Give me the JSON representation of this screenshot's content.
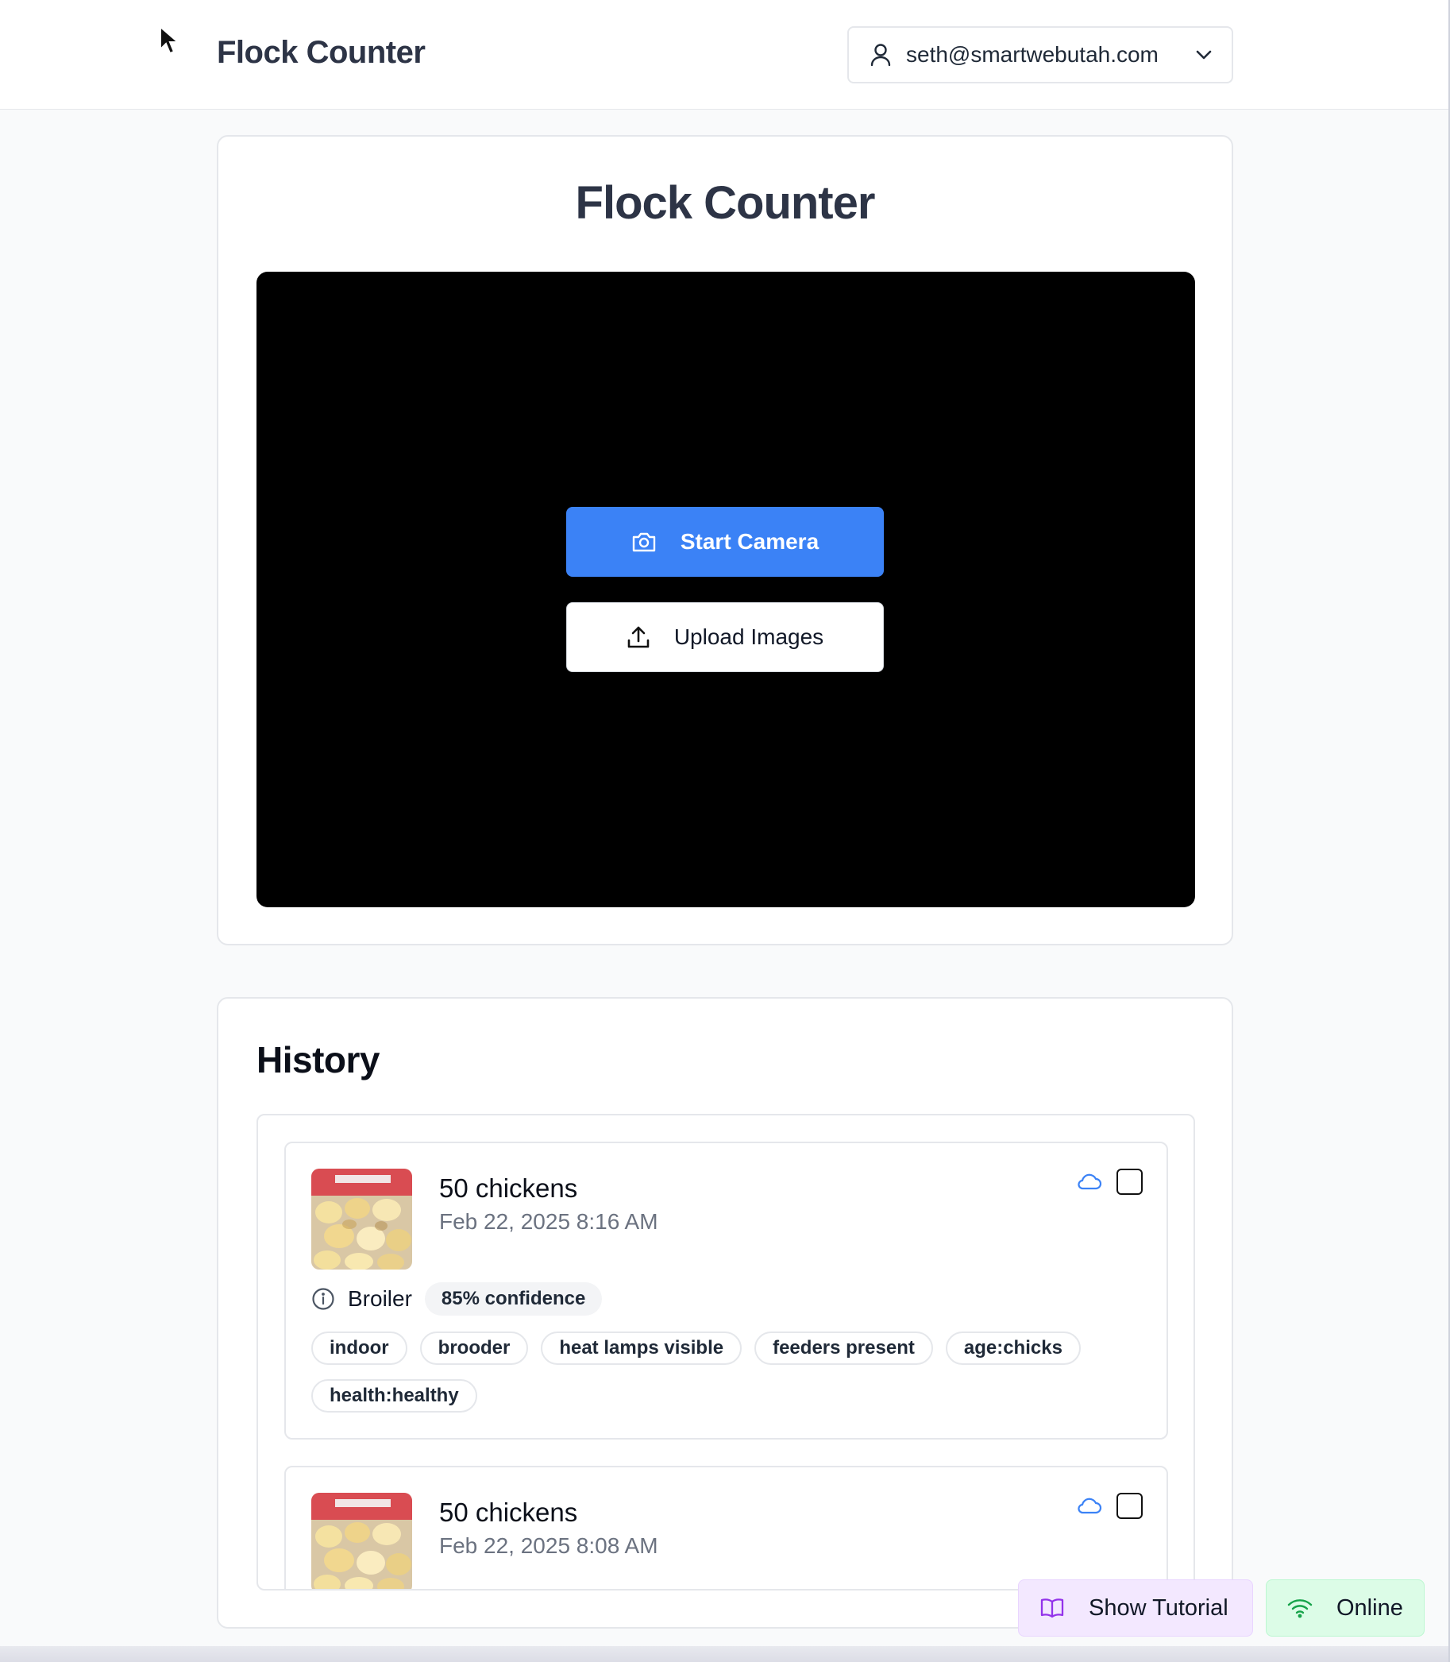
{
  "header": {
    "title": "Flock Counter",
    "user_email": "seth@smartwebutah.com"
  },
  "main": {
    "title": "Flock Counter",
    "start_camera_label": "Start Camera",
    "upload_images_label": "Upload Images"
  },
  "history": {
    "title": "History",
    "entries": [
      {
        "count": "50 chickens",
        "date": "Feb 22, 2025 8:16 AM",
        "breed": "Broiler",
        "confidence": "85% confidence",
        "tags": [
          "indoor",
          "brooder",
          "heat lamps visible",
          "feeders present",
          "age:chicks",
          "health:healthy"
        ]
      },
      {
        "count": "50 chickens",
        "date": "Feb 22, 2025 8:08 AM"
      }
    ]
  },
  "footer_buttons": {
    "tutorial_label": "Show Tutorial",
    "status_label": "Online"
  },
  "colors": {
    "primary": "#3b82f6",
    "tutorial_bg": "#f3e8ff",
    "online_bg": "#dcfce7",
    "cloud_icon": "#3b82f6"
  }
}
